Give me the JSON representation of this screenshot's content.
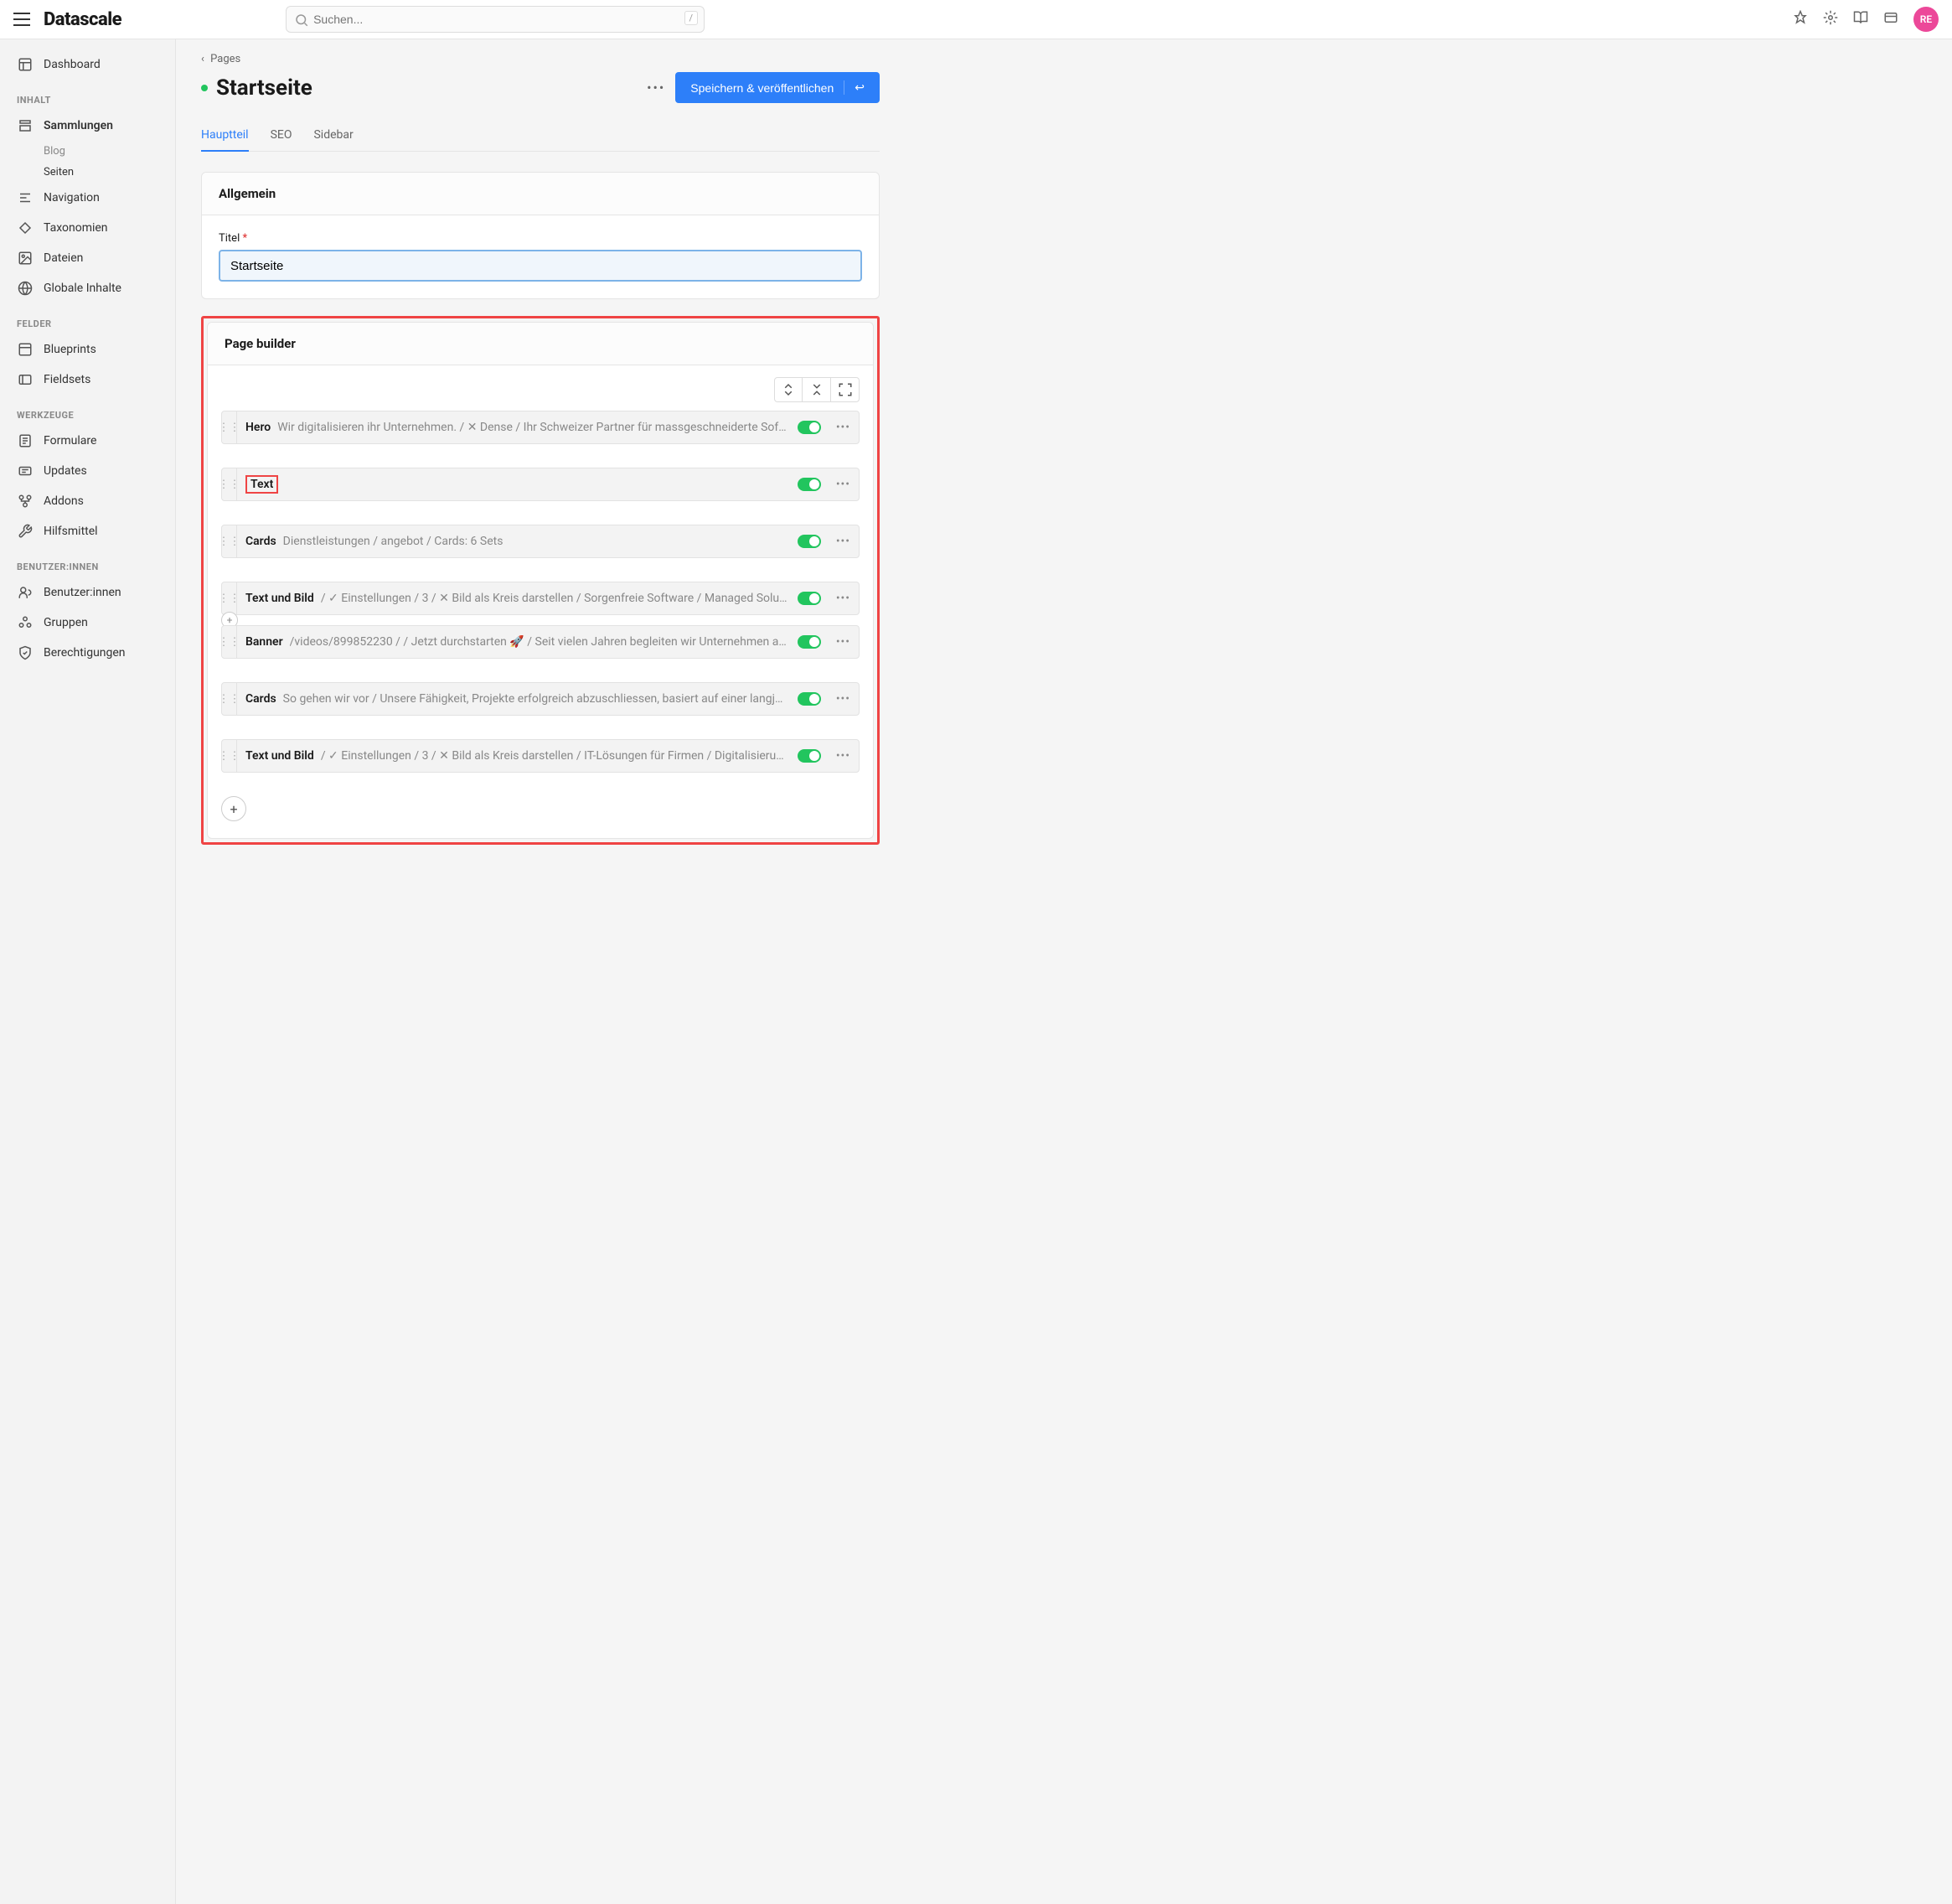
{
  "app": {
    "logo": "Datascale",
    "search_placeholder": "Suchen...",
    "search_kbd": "/",
    "avatar": "RE"
  },
  "sidebar": {
    "top": {
      "dashboard": "Dashboard"
    },
    "sections": {
      "inhalt": {
        "label": "INHALT",
        "items": {
          "sammlungen": "Sammlungen",
          "blog": "Blog",
          "seiten": "Seiten",
          "navigation": "Navigation",
          "taxonomien": "Taxonomien",
          "dateien": "Dateien",
          "globale": "Globale Inhalte"
        }
      },
      "felder": {
        "label": "FELDER",
        "items": {
          "blueprints": "Blueprints",
          "fieldsets": "Fieldsets"
        }
      },
      "werkzeuge": {
        "label": "WERKZEUGE",
        "items": {
          "formulare": "Formulare",
          "updates": "Updates",
          "addons": "Addons",
          "hilfsmittel": "Hilfsmittel"
        }
      },
      "benutzer": {
        "label": "BENUTZER:INNEN",
        "items": {
          "benutzer": "Benutzer:innen",
          "gruppen": "Gruppen",
          "berechtigungen": "Berechtigungen"
        }
      }
    }
  },
  "page": {
    "breadcrumb_parent": "Pages",
    "title": "Startseite",
    "save_button": "Speichern & veröffentlichen",
    "tabs": {
      "main": "Hauptteil",
      "seo": "SEO",
      "sidebar": "Sidebar"
    },
    "general": {
      "heading": "Allgemein",
      "title_label": "Titel",
      "title_value": "Startseite"
    },
    "pagebuilder": {
      "heading": "Page builder",
      "blocks": [
        {
          "name": "Hero",
          "desc": "Wir digitalisieren ihr Unternehmen. / ✕ Dense / Ihr Schweizer Partner für massgeschneiderte Softwarelös…"
        },
        {
          "name": "Text",
          "desc": "",
          "highlighted": true
        },
        {
          "name": "Cards",
          "desc": "Dienstleistungen / angebot / Cards: 6 Sets"
        },
        {
          "name": "Text und Bild",
          "desc": "/ ✓ Einstellungen / 3 / ✕ Bild als Kreis darstellen / Sorgenfreie Software / Managed Solutions / Wir…",
          "show_add": true
        },
        {
          "name": "Banner",
          "desc": "/videos/899852230 / / Jetzt durchstarten 🚀 / Seit vielen Jahren begleiten wir Unternehmen auf dem W…"
        },
        {
          "name": "Cards",
          "desc": "So gehen wir vor / Unsere Fähigkeit, Projekte erfolgreich abzuschliessen, basiert auf einer langjährigen E…"
        },
        {
          "name": "Text und Bild",
          "desc": "/ ✓ Einstellungen / 3 / ✕ Bild als Kreis darstellen / IT-Lösungen für Firmen / Digitalisierung für KM…"
        }
      ]
    }
  }
}
